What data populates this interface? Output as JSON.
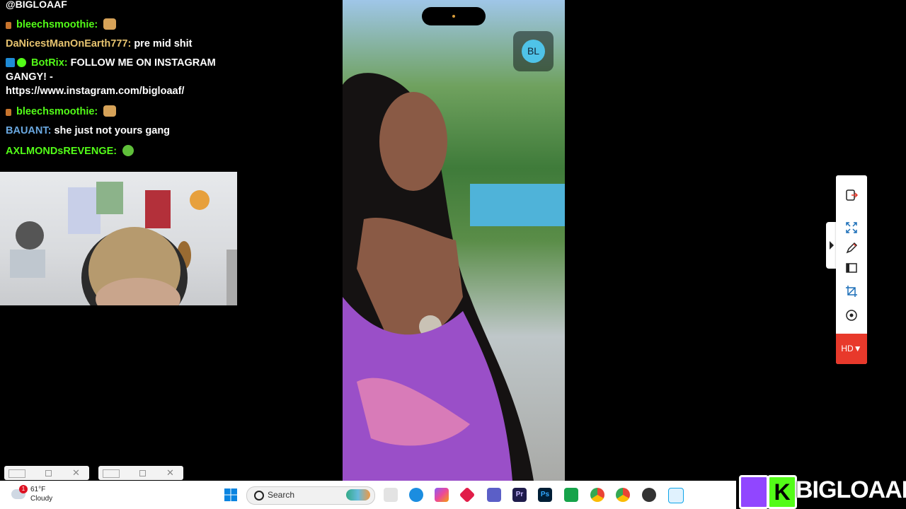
{
  "chat": {
    "header": "@BIGLOAAF",
    "messages": [
      {
        "user": "bleechsmoothie",
        "sep": ":",
        "text": "",
        "user_color": "#53fc18",
        "emote": "bread-emote"
      },
      {
        "user": "DaNicestManOnEarth777",
        "sep": ":",
        "text": "pre mid shit",
        "user_color": "#e6c36f"
      },
      {
        "user": "BotRix",
        "sep": ":",
        "text": "FOLLOW ME ON INSTAGRAM GANGY! - https://www.instagram.com/bigloaaf/",
        "user_color": "#53fc18",
        "badges": [
          "bot-badge",
          "verified-badge"
        ]
      },
      {
        "user": "bleechsmoothie",
        "sep": ":",
        "text": "",
        "user_color": "#53fc18",
        "emote": "bread-emote"
      },
      {
        "user": "BAUANT",
        "sep": ":",
        "text": "she just not yours gang",
        "user_color": "#6aa8e0"
      },
      {
        "user": "AXLMONDsREVENGE",
        "sep": ":",
        "text": "",
        "user_color": "#53fc18",
        "emote": "sick-emote"
      }
    ]
  },
  "phone": {
    "avatar_initials": "BL"
  },
  "toolbar": {
    "hd_label": "HD▼",
    "icons": [
      "exit-icon",
      "expand-icon",
      "pen-icon",
      "window-icon",
      "crop-icon",
      "record-icon"
    ]
  },
  "taskbar": {
    "weather_temp": "61°F",
    "weather_cond": "Cloudy",
    "weather_badge": "1",
    "search_placeholder": "Search",
    "ps_label": "Ps",
    "pr_label": "Pr"
  },
  "overlay": {
    "handle": "BIGLOAAF",
    "kick_letter": "K"
  }
}
